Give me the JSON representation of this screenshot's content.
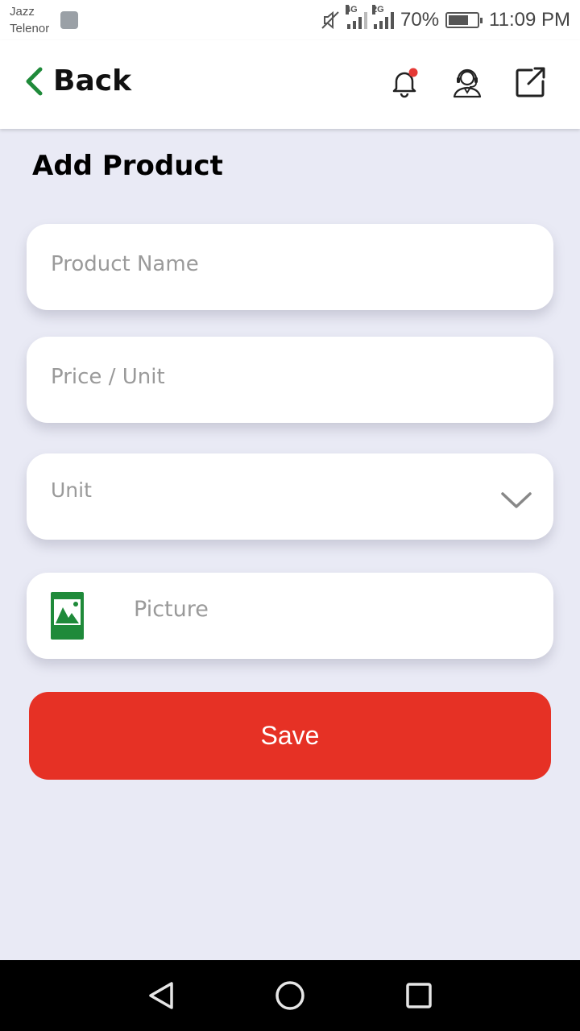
{
  "status_bar": {
    "carrier_1": "Jazz",
    "carrier_2": "Telenor",
    "signal_1_tag": "4G",
    "signal_2_tag": "2G",
    "battery": "70%",
    "time": "11:09 PM"
  },
  "header": {
    "back_label": "Back",
    "icons": [
      "bell-notification-icon",
      "support-agent-icon",
      "share-external-icon"
    ],
    "notification_dot_color": "#e53935",
    "accent_color": "#1f8a3a"
  },
  "page": {
    "title": "Add Product"
  },
  "form": {
    "product_name_placeholder": "Product Name",
    "price_placeholder": "Price / Unit",
    "unit_label": "Unit",
    "picture_label": "Picture",
    "save_label": "Save",
    "save_color": "#e63125"
  },
  "nav_bar": {
    "buttons": [
      "back-triangle-icon",
      "home-circle-icon",
      "recents-square-icon"
    ]
  }
}
